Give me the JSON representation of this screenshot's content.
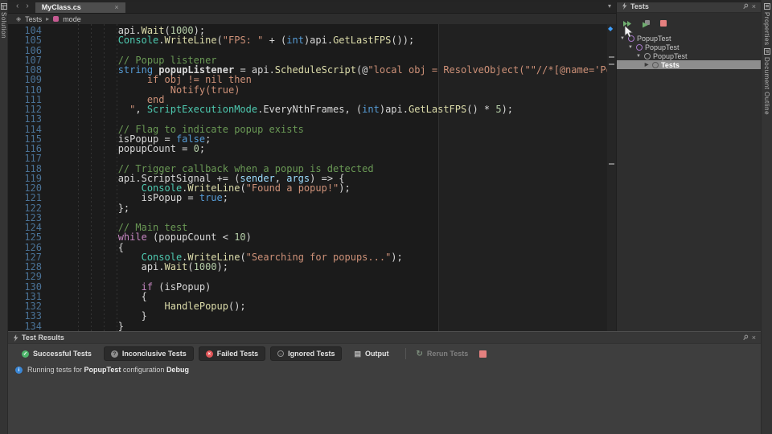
{
  "colors": {
    "keyword": "#569cd6",
    "control": "#c586c0",
    "string": "#ce9178",
    "comment": "#6a9955",
    "number": "#b5cea8",
    "type": "#4ec9b0",
    "method": "#dcdcaa",
    "param": "#9cdcfe",
    "plain": "#d8d8d8",
    "lineno": "#4a7296",
    "accent_blue": "#3fa0ff",
    "stop_pink": "#e5807f",
    "success_green": "#4db56a",
    "fail_red": "#e05558",
    "info_blue": "#3a87d6",
    "selection_gray": "#8d8d8d"
  },
  "glyphs": {
    "back": "‹",
    "forward": "›",
    "close": "×",
    "overflow": "▾",
    "breadcrumb_icon": "◈",
    "breadcrumb_sep": "▸",
    "diamond": "◆",
    "tree_collapse": "▼",
    "tree_expand": "▶",
    "rerun": "↻"
  },
  "tabbar": {
    "tab_label": "MyClass.cs"
  },
  "breadcrumb": {
    "root": "Tests",
    "item": "mode"
  },
  "side_tabs": {
    "left": [
      "Solution"
    ],
    "right": [
      "Properties",
      "Document Outline"
    ]
  },
  "tests_panel": {
    "title": "Tests",
    "tree": [
      {
        "label": "PopupTest",
        "indent": 3,
        "expanded": true,
        "icon": "purple",
        "selected": false
      },
      {
        "label": "PopupTest",
        "indent": 13,
        "expanded": true,
        "icon": "purple",
        "selected": false
      },
      {
        "label": "PopupTest",
        "indent": 23,
        "expanded": true,
        "icon": "gray",
        "selected": false
      },
      {
        "label": "Tests",
        "indent": 33,
        "expanded": false,
        "icon": "gray",
        "selected": true
      }
    ]
  },
  "results_panel": {
    "title": "Test Results",
    "filters": [
      {
        "label": "Successful Tests",
        "icon": "success",
        "boxed": false
      },
      {
        "label": "Inconclusive Tests",
        "icon": "inconclusive",
        "boxed": true
      },
      {
        "label": "Failed Tests",
        "icon": "failed",
        "boxed": true
      },
      {
        "label": "Ignored Tests",
        "icon": "ignored",
        "boxed": true
      },
      {
        "label": "Output",
        "icon": "output",
        "boxed": false
      }
    ],
    "icon_glyphs": {
      "success": "✓",
      "inconclusive": "?",
      "failed": "×",
      "ignored": "–",
      "output": "▤"
    },
    "rerun_label": "Rerun Tests",
    "status": {
      "prefix": "Running tests for ",
      "config": "PopupTest",
      "middle": " configuration ",
      "mode": "Debug"
    }
  },
  "editor": {
    "lines": [
      {
        "n": 104,
        "seg": [
          [
            "v",
            "            api."
          ],
          [
            "m",
            "Wait"
          ],
          [
            "v",
            "("
          ],
          [
            "n",
            "1000"
          ],
          [
            "v",
            ");"
          ]
        ]
      },
      {
        "n": 105,
        "seg": [
          [
            "v",
            "            "
          ],
          [
            "t",
            "Console"
          ],
          [
            "v",
            "."
          ],
          [
            "m",
            "WriteLine"
          ],
          [
            "v",
            "("
          ],
          [
            "s",
            "\"FPS: \""
          ],
          [
            "v",
            " + ("
          ],
          [
            "k",
            "int"
          ],
          [
            "v",
            ")api."
          ],
          [
            "m",
            "GetLastFPS"
          ],
          [
            "v",
            "());"
          ]
        ]
      },
      {
        "n": 106,
        "seg": []
      },
      {
        "n": 107,
        "seg": [
          [
            "v",
            "            "
          ],
          [
            "c",
            "// Popup listener"
          ]
        ]
      },
      {
        "n": 108,
        "seg": [
          [
            "v",
            "            "
          ],
          [
            "k",
            "string"
          ],
          [
            "v",
            " "
          ],
          [
            "d",
            "popupListener"
          ],
          [
            "v",
            " = api."
          ],
          [
            "m",
            "ScheduleScript"
          ],
          [
            "v",
            "(@"
          ],
          [
            "s",
            "\"local obj = ResolveObject(\"\"//*[@name='Popup(Clone)']\"\");"
          ]
        ]
      },
      {
        "n": 109,
        "seg": [
          [
            "s",
            "                 if obj != nil then"
          ]
        ]
      },
      {
        "n": 110,
        "seg": [
          [
            "s",
            "                     Notify(true)"
          ]
        ]
      },
      {
        "n": 111,
        "seg": [
          [
            "s",
            "                 end"
          ]
        ]
      },
      {
        "n": 112,
        "seg": [
          [
            "s",
            "              \""
          ],
          [
            "v",
            ", "
          ],
          [
            "t",
            "ScriptExecutionMode"
          ],
          [
            "v",
            ".EveryNthFrames, ("
          ],
          [
            "k",
            "int"
          ],
          [
            "v",
            ")api."
          ],
          [
            "m",
            "GetLastFPS"
          ],
          [
            "v",
            "() * "
          ],
          [
            "n",
            "5"
          ],
          [
            "v",
            ");"
          ]
        ]
      },
      {
        "n": 113,
        "seg": []
      },
      {
        "n": 114,
        "seg": [
          [
            "v",
            "            "
          ],
          [
            "c",
            "// Flag to indicate popup exists"
          ]
        ]
      },
      {
        "n": 115,
        "seg": [
          [
            "v",
            "            isPopup = "
          ],
          [
            "k",
            "false"
          ],
          [
            "v",
            ";"
          ]
        ]
      },
      {
        "n": 116,
        "seg": [
          [
            "v",
            "            popupCount = "
          ],
          [
            "n",
            "0"
          ],
          [
            "v",
            ";"
          ]
        ]
      },
      {
        "n": 117,
        "seg": []
      },
      {
        "n": 118,
        "seg": [
          [
            "v",
            "            "
          ],
          [
            "c",
            "// Trigger callback when a popup is detected"
          ]
        ]
      },
      {
        "n": 119,
        "seg": [
          [
            "v",
            "            api.ScriptSignal += ("
          ],
          [
            "p",
            "sender"
          ],
          [
            "v",
            ", "
          ],
          [
            "p",
            "args"
          ],
          [
            "v",
            ") => {"
          ]
        ]
      },
      {
        "n": 120,
        "seg": [
          [
            "v",
            "                "
          ],
          [
            "t",
            "Console"
          ],
          [
            "v",
            "."
          ],
          [
            "m",
            "WriteLine"
          ],
          [
            "v",
            "("
          ],
          [
            "s",
            "\"Found a popup!\""
          ],
          [
            "v",
            ");"
          ]
        ]
      },
      {
        "n": 121,
        "seg": [
          [
            "v",
            "                isPopup = "
          ],
          [
            "k",
            "true"
          ],
          [
            "v",
            ";"
          ]
        ]
      },
      {
        "n": 122,
        "seg": [
          [
            "v",
            "            };"
          ]
        ]
      },
      {
        "n": 123,
        "seg": []
      },
      {
        "n": 124,
        "seg": [
          [
            "v",
            "            "
          ],
          [
            "c",
            "// Main test"
          ]
        ]
      },
      {
        "n": 125,
        "seg": [
          [
            "v",
            "            "
          ],
          [
            "w",
            "while"
          ],
          [
            "v",
            " (popupCount < "
          ],
          [
            "n",
            "10"
          ],
          [
            "v",
            ")"
          ]
        ]
      },
      {
        "n": 126,
        "seg": [
          [
            "v",
            "            {"
          ]
        ]
      },
      {
        "n": 127,
        "seg": [
          [
            "v",
            "                "
          ],
          [
            "t",
            "Console"
          ],
          [
            "v",
            "."
          ],
          [
            "m",
            "WriteLine"
          ],
          [
            "v",
            "("
          ],
          [
            "s",
            "\"Searching for popups...\""
          ],
          [
            "v",
            ");"
          ]
        ]
      },
      {
        "n": 128,
        "seg": [
          [
            "v",
            "                api."
          ],
          [
            "m",
            "Wait"
          ],
          [
            "v",
            "("
          ],
          [
            "n",
            "1000"
          ],
          [
            "v",
            ");"
          ]
        ]
      },
      {
        "n": 129,
        "seg": []
      },
      {
        "n": 130,
        "seg": [
          [
            "v",
            "                "
          ],
          [
            "w",
            "if"
          ],
          [
            "v",
            " (isPopup)"
          ]
        ]
      },
      {
        "n": 131,
        "seg": [
          [
            "v",
            "                {"
          ]
        ]
      },
      {
        "n": 132,
        "seg": [
          [
            "v",
            "                    "
          ],
          [
            "m",
            "HandlePopup"
          ],
          [
            "v",
            "();"
          ]
        ]
      },
      {
        "n": 133,
        "seg": [
          [
            "v",
            "                }"
          ]
        ]
      },
      {
        "n": 134,
        "seg": [
          [
            "v",
            "            }"
          ]
        ]
      }
    ]
  }
}
